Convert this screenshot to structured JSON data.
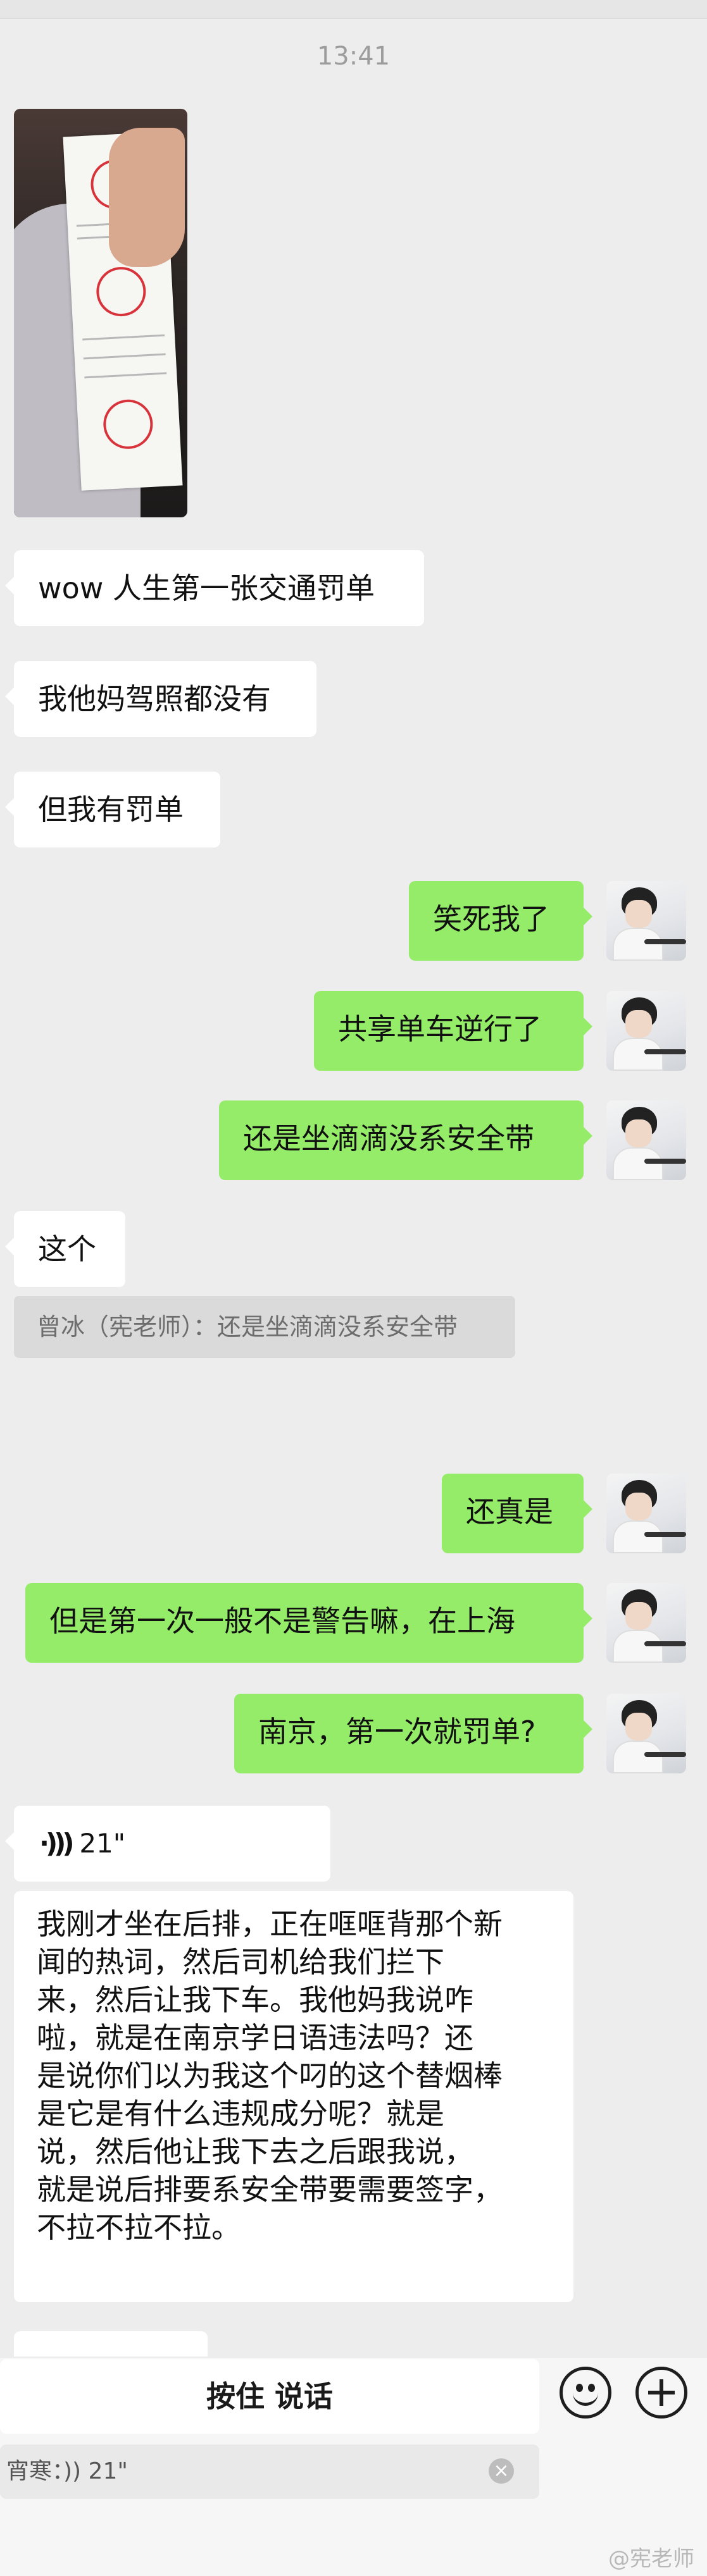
{
  "timestamp": "13:41",
  "photo": {
    "icon": "traffic-ticket-photo"
  },
  "messages": [
    {
      "side": "in",
      "text": "wow 人生第一张交通罚单"
    },
    {
      "side": "in",
      "text": "我他妈驾照都没有"
    },
    {
      "side": "in",
      "text": "但我有罚单"
    },
    {
      "side": "out",
      "text": "笑死我了"
    },
    {
      "side": "out",
      "text": "共享单车逆行了"
    },
    {
      "side": "out",
      "text": "还是坐滴滴没系安全带"
    },
    {
      "side": "in",
      "text": "这个"
    },
    {
      "side": "out",
      "text": "还真是"
    },
    {
      "side": "out",
      "text": "但是第一次一般不是警告嘛，在上海"
    },
    {
      "side": "out",
      "text": "南京，第一次就罚单?"
    }
  ],
  "quote": "曾冰（宪老师）：还是坐滴滴没系安全带",
  "voice": {
    "icon": "voice-wave-icon",
    "duration": "21\""
  },
  "transcript": [
    "我刚才坐在后排，正在哐哐背那个新",
    "闻的热词，然后司机给我们拦下",
    "来，然后让我下车。我他妈我说咋",
    "啦，就是在南京学日语违法吗？还",
    "是说你们以为我这个叼的这个替烟棒",
    "是它是有什么违规成分呢？就是",
    "说，然后他让我下去之后跟我说，",
    "就是说后排要系安全带要需要签字，",
    "不拉不拉不拉。"
  ],
  "input": {
    "talk_label": "按住 说话",
    "reply_quote": "宵寒：)) 21\"",
    "emoji_icon": "emoji-icon",
    "plus_icon": "plus-icon"
  },
  "watermark": "@宪老师",
  "colors": {
    "background": "#ededed",
    "incoming": "#ffffff",
    "outgoing": "#95ec69"
  }
}
